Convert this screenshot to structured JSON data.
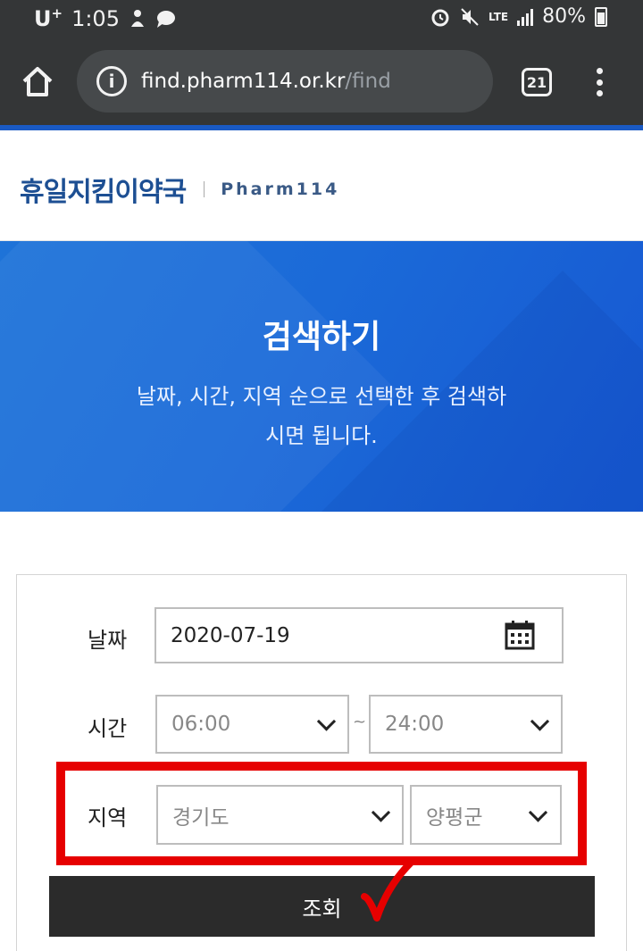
{
  "status_bar": {
    "carrier": "U",
    "carrier_plus": "+",
    "time": "1:05",
    "network": "LTE",
    "battery": "80%"
  },
  "browser": {
    "url_host": "find.pharm114.or.kr",
    "url_path": "/find",
    "tab_count": "21",
    "icons": [
      "home-icon",
      "info-icon",
      "tabs-icon",
      "more-vert-icon"
    ]
  },
  "site": {
    "logo_kr": "휴일지킴이약국",
    "logo_en": "Pharm114"
  },
  "hero": {
    "title": "검색하기",
    "desc_line1": "날짜, 시간, 지역 순으로 선택한 후 검색하",
    "desc_line2": "시면 됩니다."
  },
  "form": {
    "date_label": "날짜",
    "date_value": "2020-07-19",
    "time_label": "시간",
    "time_start": "06:00",
    "time_sep": "~",
    "time_end": "24:00",
    "region_label": "지역",
    "province": "경기도",
    "county": "양평군",
    "submit_label": "조회"
  },
  "colors": {
    "status_bg": "#343637",
    "brand_blue": "#1a5ac4",
    "hero_blue": "#1b6ad8",
    "highlight_red": "#e60000",
    "button_dark": "#2b2b2b"
  }
}
